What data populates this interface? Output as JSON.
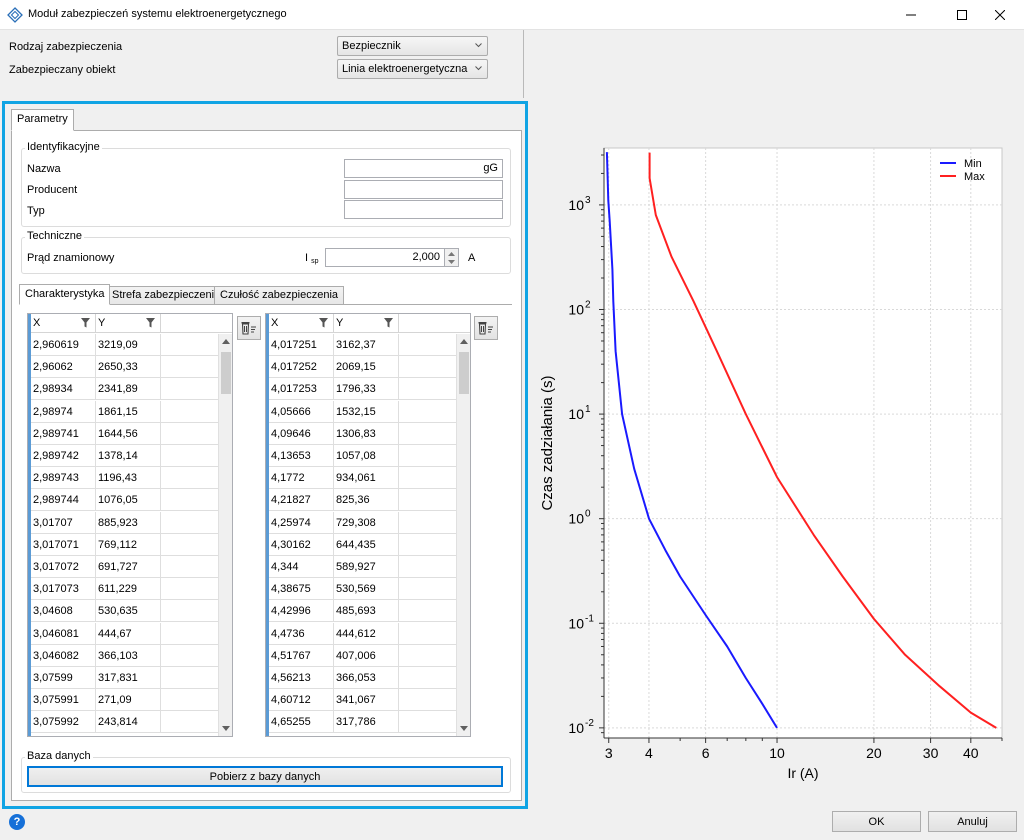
{
  "window": {
    "title": "Moduł zabezpieczeń systemu elektroenergetycznego"
  },
  "form": {
    "protection_type_label": "Rodzaj zabezpieczenia",
    "protection_type_value": "Bezpiecznik",
    "protected_object_label": "Zabezpieczany obiekt",
    "protected_object_value": "Linia elektroenergetyczna"
  },
  "tabs": {
    "params": "Parametry"
  },
  "identification": {
    "title": "Identyfikacyjne",
    "name_label": "Nazwa",
    "name_value": "gG",
    "producer_label": "Producent",
    "producer_value": "",
    "type_label": "Typ",
    "type_value": ""
  },
  "technical": {
    "title": "Techniczne",
    "rated_current_label": "Prąd znamionowy",
    "isp_main": "I",
    "isp_sub": "sp",
    "rated_current_value": "2,000",
    "unit": "A"
  },
  "subtabs": {
    "characteristic": "Charakterystyka",
    "zone": "Strefa zabezpieczenia",
    "sensitivity": "Czułość zabezpieczenia"
  },
  "grid_min": {
    "col_x": "X",
    "col_y": "Y",
    "rows": [
      [
        "2,960619",
        "3219,09"
      ],
      [
        "2,96062",
        "2650,33"
      ],
      [
        "2,98934",
        "2341,89"
      ],
      [
        "2,98974",
        "1861,15"
      ],
      [
        "2,989741",
        "1644,56"
      ],
      [
        "2,989742",
        "1378,14"
      ],
      [
        "2,989743",
        "1196,43"
      ],
      [
        "2,989744",
        "1076,05"
      ],
      [
        "3,01707",
        "885,923"
      ],
      [
        "3,017071",
        "769,112"
      ],
      [
        "3,017072",
        "691,727"
      ],
      [
        "3,017073",
        "611,229"
      ],
      [
        "3,04608",
        "530,635"
      ],
      [
        "3,046081",
        "444,67"
      ],
      [
        "3,046082",
        "366,103"
      ],
      [
        "3,07599",
        "317,831"
      ],
      [
        "3,075991",
        "271,09"
      ],
      [
        "3,075992",
        "243,814"
      ]
    ]
  },
  "grid_max": {
    "col_x": "X",
    "col_y": "Y",
    "rows": [
      [
        "4,017251",
        "3162,37"
      ],
      [
        "4,017252",
        "2069,15"
      ],
      [
        "4,017253",
        "1796,33"
      ],
      [
        "4,05666",
        "1532,15"
      ],
      [
        "4,09646",
        "1306,83"
      ],
      [
        "4,13653",
        "1057,08"
      ],
      [
        "4,1772",
        "934,061"
      ],
      [
        "4,21827",
        "825,36"
      ],
      [
        "4,25974",
        "729,308"
      ],
      [
        "4,30162",
        "644,435"
      ],
      [
        "4,344",
        "589,927"
      ],
      [
        "4,38675",
        "530,569"
      ],
      [
        "4,42996",
        "485,693"
      ],
      [
        "4,4736",
        "444,612"
      ],
      [
        "4,51767",
        "407,006"
      ],
      [
        "4,56213",
        "366,053"
      ],
      [
        "4,60712",
        "341,067"
      ],
      [
        "4,65255",
        "317,786"
      ]
    ]
  },
  "database": {
    "title": "Baza danych",
    "fetch_label": "Pobierz z bazy danych"
  },
  "footer": {
    "ok_label": "OK",
    "cancel_label": "Anuluj",
    "help_glyph": "?"
  },
  "colors": {
    "accent_border": "#10a4e4",
    "series_min": "#1a1aff",
    "series_max": "#ff2020"
  },
  "chart_data": {
    "type": "line",
    "xscale": "log",
    "yscale": "log",
    "xlabel": "Ir (A)",
    "ylabel": "Czas zadziałania (s)",
    "xlim": [
      2.9,
      50
    ],
    "ylim": [
      0.008,
      3500
    ],
    "xticks": [
      3,
      4,
      6,
      10,
      20,
      30,
      40
    ],
    "yticks": [
      0.01,
      0.1,
      1,
      10,
      100,
      1000
    ],
    "ytick_labels": [
      {
        "base": "10",
        "exp": "-2"
      },
      {
        "base": "10",
        "exp": "-1"
      },
      {
        "base": "10",
        "exp": "0"
      },
      {
        "base": "10",
        "exp": "1"
      },
      {
        "base": "10",
        "exp": "2"
      },
      {
        "base": "10",
        "exp": "3"
      }
    ],
    "grid": true,
    "legend_position": "top-right",
    "series": [
      {
        "name": "Min",
        "color": "#1a1aff",
        "x": [
          2.96,
          2.99,
          3.02,
          3.08,
          3.1,
          3.15,
          3.3,
          3.6,
          4.0,
          4.5,
          5.0,
          6.0,
          7.0,
          8.0,
          9.0,
          10.0
        ],
        "y": [
          3200,
          1100,
          700,
          243,
          120,
          40,
          10,
          3,
          1,
          0.5,
          0.28,
          0.12,
          0.06,
          0.03,
          0.017,
          0.01
        ]
      },
      {
        "name": "Max",
        "color": "#ff2020",
        "x": [
          4.02,
          4.02,
          4.2,
          4.7,
          5.5,
          6.5,
          8.0,
          10.0,
          13.0,
          16.0,
          20.0,
          25.0,
          32.0,
          40.0,
          48.0
        ],
        "y": [
          3162,
          1800,
          800,
          320,
          120,
          40,
          10,
          2.5,
          0.7,
          0.28,
          0.11,
          0.05,
          0.025,
          0.014,
          0.01
        ]
      }
    ]
  }
}
